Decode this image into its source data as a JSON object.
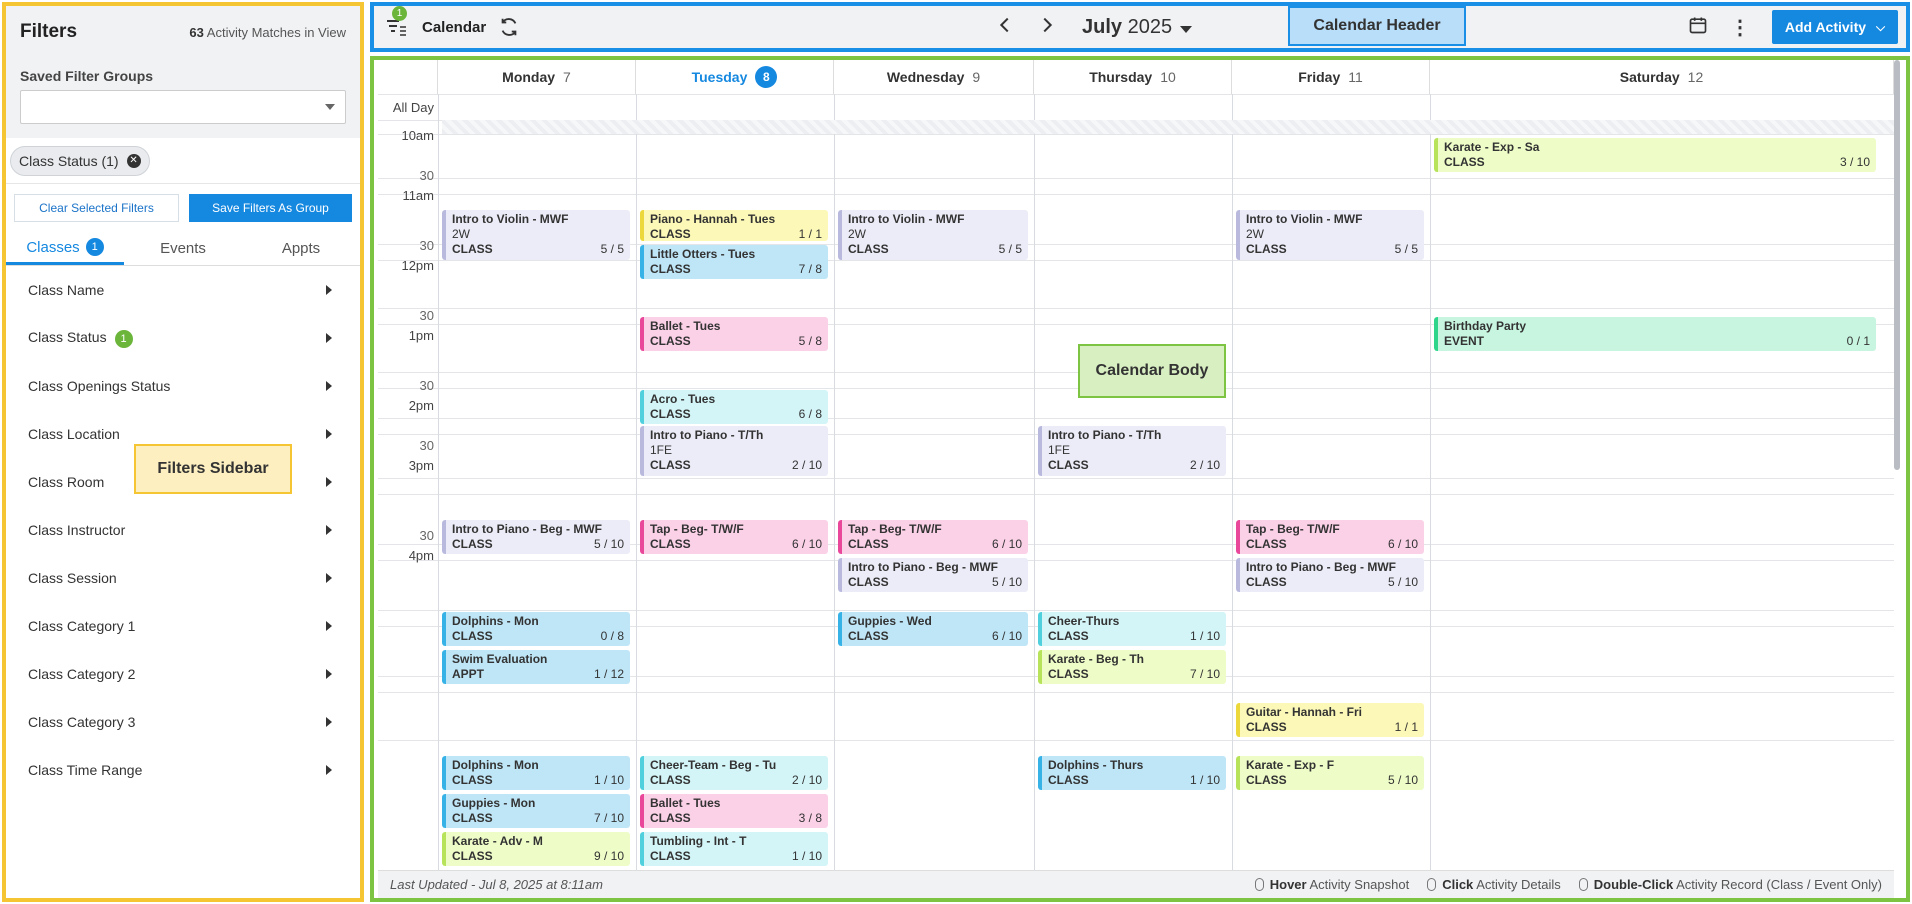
{
  "sidebar": {
    "title": "Filters",
    "match_count": "63",
    "match_text": "Activity Matches in View",
    "saved_groups_label": "Saved Filter Groups",
    "saved_groups_value": "",
    "chip_label": "Class Status (1)",
    "clear_button": "Clear Selected Filters",
    "save_button": "Save Filters As Group",
    "tabs": [
      {
        "label": "Classes",
        "badge": "1"
      },
      {
        "label": "Events"
      },
      {
        "label": "Appts"
      }
    ],
    "filters": [
      {
        "label": "Class Name"
      },
      {
        "label": "Class Status",
        "badge": "1"
      },
      {
        "label": "Class Openings Status"
      },
      {
        "label": "Class Location"
      },
      {
        "label": "Class Room"
      },
      {
        "label": "Class Instructor"
      },
      {
        "label": "Class Session"
      },
      {
        "label": "Class Category 1"
      },
      {
        "label": "Class Category 2"
      },
      {
        "label": "Class Category 3"
      },
      {
        "label": "Class Time Range"
      }
    ]
  },
  "header": {
    "filter_badge": "1",
    "title": "Calendar",
    "month": "July",
    "year": "2025",
    "add_button": "Add Activity"
  },
  "calendar": {
    "all_day_label": "All Day",
    "days": [
      {
        "name": "Monday",
        "num": "7"
      },
      {
        "name": "Tuesday",
        "num": "8",
        "today": true
      },
      {
        "name": "Wednesday",
        "num": "9"
      },
      {
        "name": "Thursday",
        "num": "10"
      },
      {
        "name": "Friday",
        "num": "11"
      },
      {
        "name": "Saturday",
        "num": "12"
      }
    ],
    "time_labels": [
      "10am",
      "30",
      "11am",
      "30",
      "12pm",
      "30",
      "1pm",
      "30",
      "2pm",
      "30",
      "3pm",
      "30",
      "4pm"
    ],
    "events": [
      {
        "day": 5,
        "title": "Karate - Exp - Sa",
        "type": "CLASS",
        "count": "3 / 10",
        "color": "lime"
      },
      {
        "day": 0,
        "title": "Intro to Violin - MWF",
        "sub": "2W",
        "type": "CLASS",
        "count": "5 / 5",
        "color": "violet"
      },
      {
        "day": 1,
        "title": "Piano - Hannah - Tues",
        "type": "CLASS",
        "count": "1 / 1",
        "color": "yellow"
      },
      {
        "day": 1,
        "title": "Little Otters - Tues",
        "type": "CLASS",
        "count": "7 / 8",
        "color": "blue"
      },
      {
        "day": 2,
        "title": "Intro to Violin - MWF",
        "sub": "2W",
        "type": "CLASS",
        "count": "5 / 5",
        "color": "violet"
      },
      {
        "day": 4,
        "title": "Intro to Violin - MWF",
        "sub": "2W",
        "type": "CLASS",
        "count": "5 / 5",
        "color": "violet"
      },
      {
        "day": 1,
        "title": "Ballet - Tues",
        "type": "CLASS",
        "count": "5 / 8",
        "color": "pink"
      },
      {
        "day": 5,
        "title": "Birthday Party",
        "type": "EVENT",
        "count": "0 / 1",
        "color": "green"
      },
      {
        "day": 1,
        "title": "Acro - Tues",
        "type": "CLASS",
        "count": "6 / 8",
        "color": "cyan"
      },
      {
        "day": 1,
        "title": "Intro to Piano - T/Th",
        "sub": "1FE",
        "type": "CLASS",
        "count": "2 / 10",
        "color": "violet"
      },
      {
        "day": 3,
        "title": "Intro to Piano - T/Th",
        "sub": "1FE",
        "type": "CLASS",
        "count": "2 / 10",
        "color": "violet"
      },
      {
        "day": 0,
        "title": "Intro to Piano - Beg - MWF",
        "type": "CLASS",
        "count": "5 / 10",
        "color": "violet"
      },
      {
        "day": 1,
        "title": "Tap - Beg- T/W/F",
        "type": "CLASS",
        "count": "6 / 10",
        "color": "pink"
      },
      {
        "day": 2,
        "title": "Tap - Beg- T/W/F",
        "type": "CLASS",
        "count": "6 / 10",
        "color": "pink"
      },
      {
        "day": 2,
        "title": "Intro to Piano - Beg - MWF",
        "type": "CLASS",
        "count": "5 / 10",
        "color": "violet"
      },
      {
        "day": 4,
        "title": "Tap - Beg- T/W/F",
        "type": "CLASS",
        "count": "6 / 10",
        "color": "pink"
      },
      {
        "day": 4,
        "title": "Intro to Piano - Beg - MWF",
        "type": "CLASS",
        "count": "5 / 10",
        "color": "violet"
      },
      {
        "day": 0,
        "title": "Dolphins - Mon",
        "type": "CLASS",
        "count": "0 / 8",
        "color": "blue"
      },
      {
        "day": 0,
        "title": "Swim Evaluation",
        "type": "APPT",
        "count": "1 / 12",
        "color": "blue"
      },
      {
        "day": 2,
        "title": "Guppies - Wed",
        "type": "CLASS",
        "count": "6 / 10",
        "color": "blue"
      },
      {
        "day": 3,
        "title": "Cheer-Thurs",
        "type": "CLASS",
        "count": "1 / 10",
        "color": "cyan"
      },
      {
        "day": 3,
        "title": "Karate - Beg - Th",
        "type": "CLASS",
        "count": "7 / 10",
        "color": "lime"
      },
      {
        "day": 4,
        "title": "Guitar - Hannah - Fri",
        "type": "CLASS",
        "count": "1 / 1",
        "color": "yellow"
      },
      {
        "day": 0,
        "title": "Dolphins - Mon",
        "type": "CLASS",
        "count": "1 / 10",
        "color": "blue"
      },
      {
        "day": 0,
        "title": "Guppies - Mon",
        "type": "CLASS",
        "count": "7 / 10",
        "color": "blue"
      },
      {
        "day": 0,
        "title": "Karate - Adv - M",
        "type": "CLASS",
        "count": "9 / 10",
        "color": "lime"
      },
      {
        "day": 1,
        "title": "Cheer-Team - Beg - Tu",
        "type": "CLASS",
        "count": "2 / 10",
        "color": "cyan"
      },
      {
        "day": 1,
        "title": "Ballet - Tues",
        "type": "CLASS",
        "count": "3 / 8",
        "color": "pink"
      },
      {
        "day": 1,
        "title": "Tumbling - Int - T",
        "type": "CLASS",
        "count": "1 / 10",
        "color": "cyan"
      },
      {
        "day": 3,
        "title": "Dolphins - Thurs",
        "type": "CLASS",
        "count": "1 / 10",
        "color": "blue"
      },
      {
        "day": 4,
        "title": "Karate - Exp - F",
        "type": "CLASS",
        "count": "5 / 10",
        "color": "lime"
      }
    ]
  },
  "status": {
    "updated": "Last Updated - Jul 8, 2025 at 8:11am",
    "hint1_b": "Hover",
    "hint1": "Activity Snapshot",
    "hint2_b": "Click",
    "hint2": "Activity Details",
    "hint3_b": "Double-Click",
    "hint3": "Activity Record (Class / Event Only)"
  },
  "annotations": {
    "sidebar": "Filters Sidebar",
    "header": "Calendar Header",
    "body": "Calendar Body"
  }
}
